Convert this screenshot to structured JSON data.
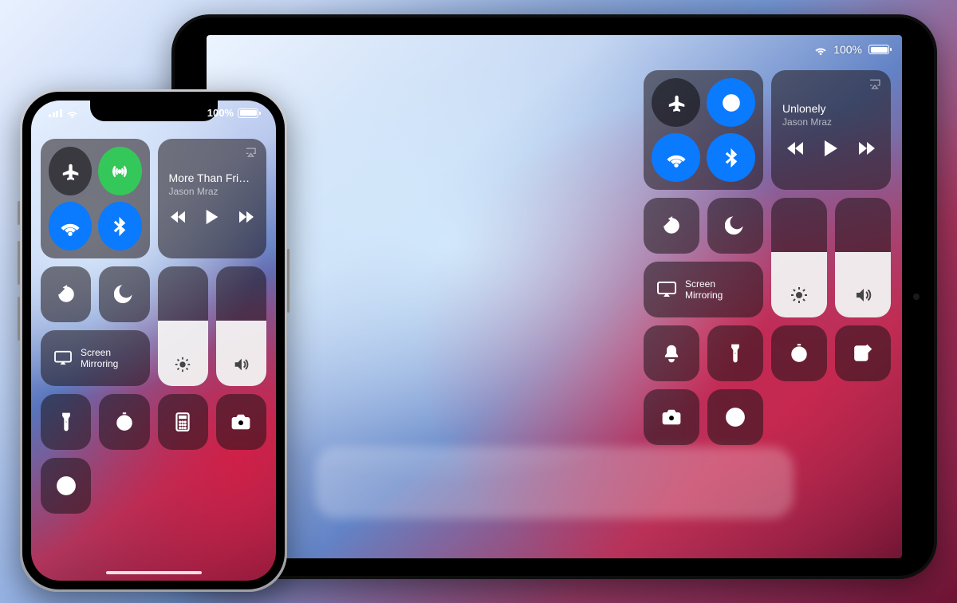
{
  "ipad": {
    "status": {
      "wifi_signal": "full",
      "battery_percent": "100%"
    },
    "connectivity": {
      "airplane": {
        "active": false
      },
      "airdrop": {
        "active": true
      },
      "wifi": {
        "active": true
      },
      "bluetooth": {
        "active": true
      }
    },
    "music": {
      "track_title": "Unlonely",
      "artist": "Jason Mraz"
    },
    "screen_mirroring_label": "Screen\nMirroring",
    "brightness_level": 0.55,
    "volume_level": 0.55,
    "shortcut_rows": [
      [
        "silent-bell",
        "flashlight",
        "timer",
        "compose"
      ],
      [
        "camera",
        "home"
      ]
    ]
  },
  "iphone": {
    "status": {
      "cell_signal": "full",
      "wifi_signal": "full",
      "battery_percent": "100%"
    },
    "connectivity": {
      "airplane": {
        "active": false
      },
      "cellular": {
        "active": true
      },
      "wifi": {
        "active": true
      },
      "bluetooth": {
        "active": true
      }
    },
    "music": {
      "track_title": "More Than Frie…",
      "artist": "Jason Mraz"
    },
    "screen_mirroring_label": "Screen\nMirroring",
    "brightness_level": 0.55,
    "volume_level": 0.55,
    "shortcut_rows": [
      [
        "flashlight",
        "timer",
        "calculator",
        "camera"
      ],
      [
        "home"
      ]
    ]
  },
  "colors": {
    "tile": "rgba(30,20,24,.55)",
    "active_blue": "#0a7aff",
    "active_green": "#34c759"
  }
}
